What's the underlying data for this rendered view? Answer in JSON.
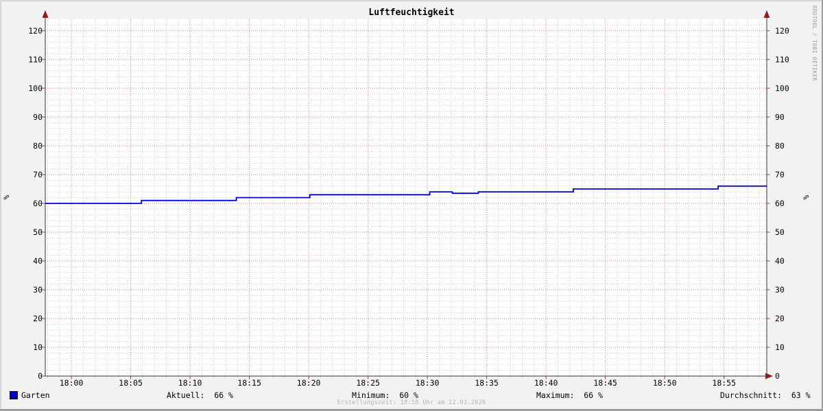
{
  "chart_data": {
    "type": "line",
    "title": "Luftfeuchtigkeit",
    "xlabel": "",
    "ylabel": "%",
    "ylim": [
      0,
      124
    ],
    "y_major_step": 10,
    "y_minor_step": 2,
    "yticks": [
      0,
      10,
      20,
      30,
      40,
      50,
      60,
      70,
      80,
      90,
      100,
      110,
      120
    ],
    "x_range_minutes": [
      -2.2,
      58.6
    ],
    "x_minor_step_minutes": 1,
    "xticks": [
      {
        "m": 0,
        "label": "18:00"
      },
      {
        "m": 5,
        "label": "18:05"
      },
      {
        "m": 10,
        "label": "18:10"
      },
      {
        "m": 15,
        "label": "18:15"
      },
      {
        "m": 20,
        "label": "18:20"
      },
      {
        "m": 25,
        "label": "18:25"
      },
      {
        "m": 30,
        "label": "18:30"
      },
      {
        "m": 35,
        "label": "18:35"
      },
      {
        "m": 40,
        "label": "18:40"
      },
      {
        "m": 45,
        "label": "18:45"
      },
      {
        "m": 50,
        "label": "18:50"
      },
      {
        "m": 55,
        "label": "18:55"
      }
    ],
    "grid": true,
    "legend_position": "bottom",
    "series": [
      {
        "name": "Garten",
        "color": "#0000cc",
        "step": true,
        "points": [
          [
            -2.2,
            60
          ],
          [
            5.9,
            61
          ],
          [
            13.9,
            62
          ],
          [
            20.1,
            63
          ],
          [
            30.2,
            64
          ],
          [
            32.1,
            63.5
          ],
          [
            34.3,
            64
          ],
          [
            42.3,
            65
          ],
          [
            54.5,
            66
          ]
        ]
      }
    ],
    "stats": {
      "aktuell_pct": 66,
      "minimum_pct": 60,
      "maximum_pct": 66,
      "durchschnitt_pct": 63
    }
  },
  "y_unit_left": "%",
  "y_unit_right": "%",
  "watermark": "RRDTOOL / TOBI OETIKER",
  "footer": "Erstellungszeit: 18:58 Uhr am 12.03.2026",
  "legend": {
    "series_label": "Garten",
    "stats": [
      {
        "label": "Aktuell",
        "value": "66 %",
        "display": "Aktuell:  66 %"
      },
      {
        "label": "Minimum",
        "value": "60 %",
        "display": "Minimum:  60 %"
      },
      {
        "label": "Maximum",
        "value": "66 %",
        "display": "Maximum:  66 %"
      },
      {
        "label": "Durchschnitt",
        "value": "63 %",
        "display": "Durchschnitt:  63 %"
      }
    ]
  },
  "colors": {
    "background": "#f2f2f2",
    "canvas": "#ffffff",
    "minor_grid": "#cbcbcb",
    "major_grid": "#dd7f7f",
    "tick": "#c03232",
    "axis": "#333333",
    "arrow": "#8b1e1e",
    "line": "#0000cc",
    "swatch": "#0000c8"
  }
}
